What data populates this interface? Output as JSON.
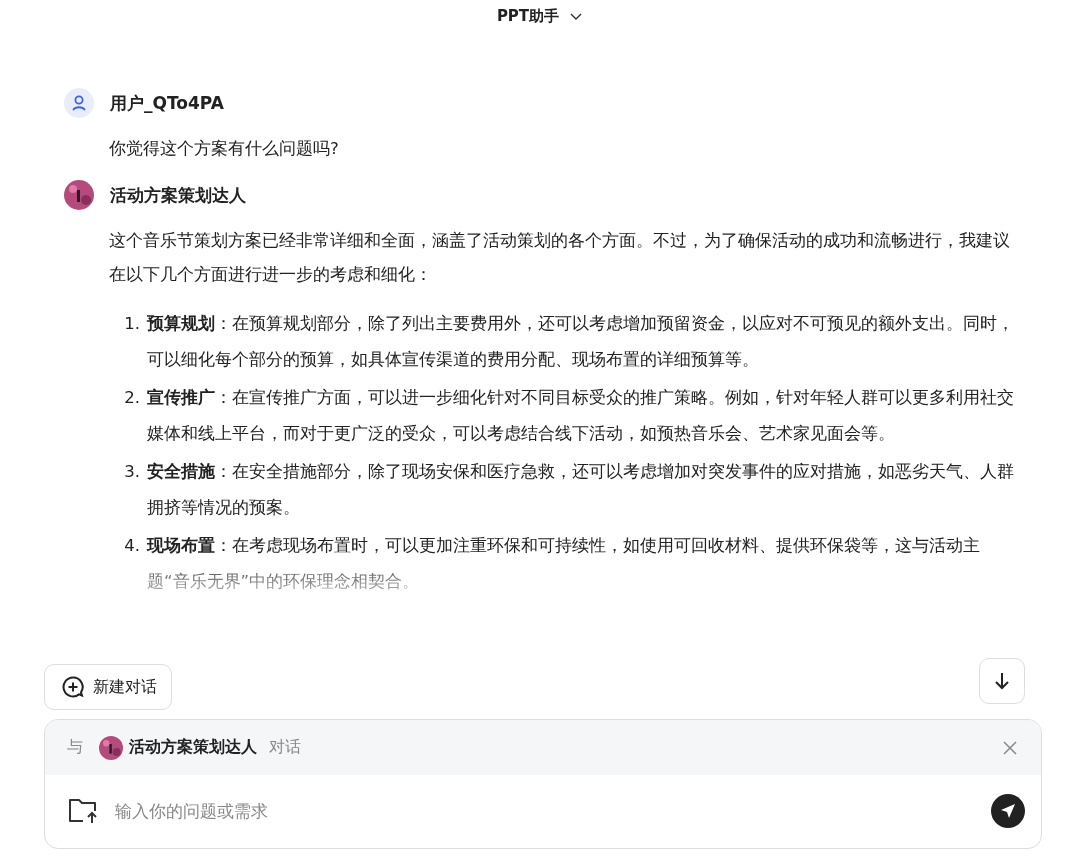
{
  "header": {
    "title": "PPT助手"
  },
  "messages": [
    {
      "kind": "user",
      "author": "用户_QTo4PA",
      "text": "你觉得这个方案有什么问题吗?"
    },
    {
      "kind": "bot",
      "author": "活动方案策划达人",
      "text": "这个音乐节策划方案已经非常详细和全面，涵盖了活动策划的各个方面。不过，为了确保活动的成功和流畅进行，我建议在以下几个方面进行进一步的考虑和细化：",
      "list": [
        {
          "number": "1.",
          "text": "**预算规划**：在预算规划部分，除了列出主要费用外，还可以考虑增加预留资金，以应对不可预见的额外支出。同时，可以细化每个部分的预算，如具体宣传渠道的费用分配、现场布置的详细预算等。"
        },
        {
          "number": "2.",
          "text": "**宣传推广**：在宣传推广方面，可以进一步细化针对不同目标受众的推广策略。例如，针对年轻人群可以更多利用社交媒体和线上平台，而对于更广泛的受众，可以考虑结合线下活动，如预热音乐会、艺术家见面会等。"
        },
        {
          "number": "3.",
          "text": "**安全措施**：在安全措施部分，除了现场安保和医疗急救，还可以考虑增加对突发事件的应对措施，如恶劣天气、人群拥挤等情况的预案。"
        },
        {
          "number": "4.",
          "text": "**现场布置**：在考虑现场布置时，可以更加注重环保和可持续性，如使用可回收材料、提供环保袋等，这与活动主题“音乐无界”中的环保理念相契合。"
        }
      ]
    }
  ],
  "new_chat_button": "新建对话",
  "composer": {
    "prefix": "与",
    "agent": "活动方案策划达人",
    "suffix": "对话",
    "placeholder": "输入你的问题或需求"
  }
}
